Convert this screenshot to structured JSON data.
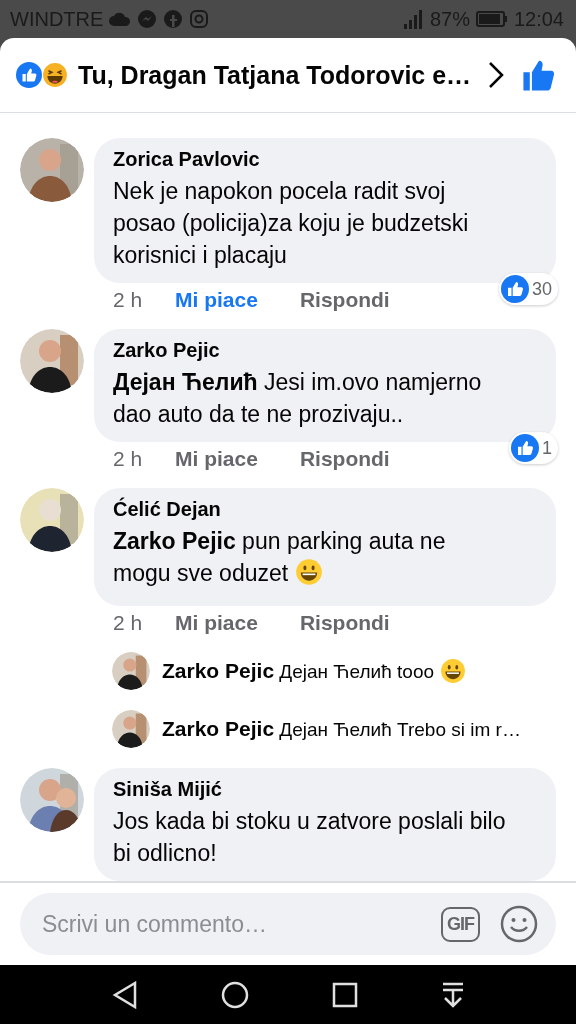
{
  "status_bar": {
    "carrier": "WINDTRE",
    "battery": "87%",
    "time": "12:04"
  },
  "header": {
    "title": "Tu, Dragan Tatjana Todorovic e…"
  },
  "comments": [
    {
      "author": "Zorica Pavlovic",
      "text": "Nek je napokon pocela radit svoj posao (policija)za koju je budzetski korisnici i placaju",
      "emoji": false,
      "time": "2 h",
      "like_label": "Mi piace",
      "reply_label": "Rispondi",
      "liked": true,
      "reactions": "30"
    },
    {
      "author": "Zarko Pejic",
      "text": "**Дејан Ћелић** Jesi im.ovo namjerno dao auto da te ne prozivaju..",
      "emoji": false,
      "time": "2 h",
      "like_label": "Mi piace",
      "reply_label": "Rispondi",
      "liked": false,
      "reactions": "1"
    },
    {
      "author": "Ćelić Dejan",
      "text": "**Zarko Pejic** pun parking auta ne mogu sve oduzet",
      "emoji": true,
      "time": "2 h",
      "like_label": "Mi piace",
      "reply_label": "Rispondi",
      "liked": false,
      "replies": [
        {
          "text": "**Zarko Pejic** Дејан Ћелић tooo",
          "emoji": true
        },
        {
          "text": "**Zarko Pejic** Дејан Ћелић Trebo si im r…",
          "emoji": false
        }
      ]
    },
    {
      "author": "Siniša Mijić",
      "text": "Jos kada bi stoku u zatvore poslali bilo bi odlicno!",
      "emoji": false
    }
  ],
  "composer": {
    "placeholder": "Scrivi un commento…",
    "gif_label": "GIF"
  }
}
